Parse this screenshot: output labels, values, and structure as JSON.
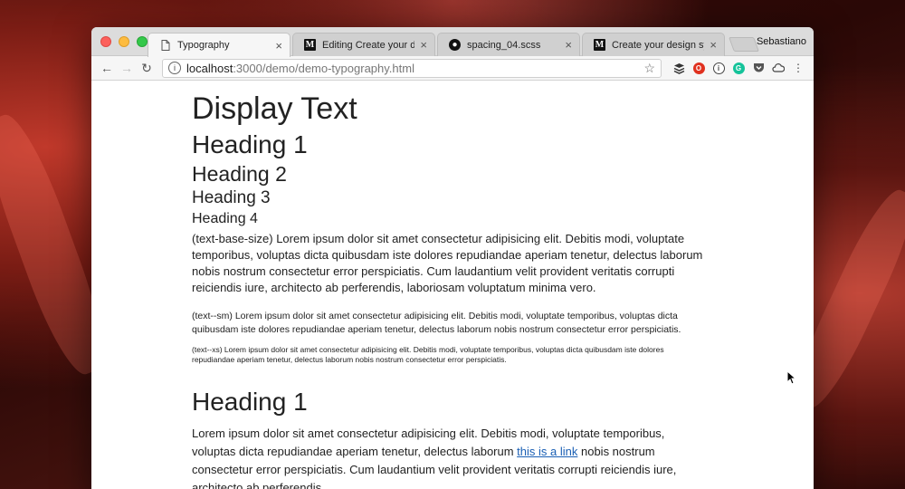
{
  "browser": {
    "tabs": [
      {
        "label": "Typography",
        "icon": "document-icon",
        "active": true
      },
      {
        "label": "Editing Create your desig",
        "icon": "medium-icon",
        "active": false
      },
      {
        "label": "spacing_04.scss",
        "icon": "github-icon",
        "active": false
      },
      {
        "label": "Create your design syste",
        "icon": "medium-icon",
        "active": false
      }
    ],
    "profile_name": "Sebastiano",
    "url_host": "localhost",
    "url_path": ":3000/demo/demo-typography.html"
  },
  "page": {
    "display_text": "Display Text",
    "heading1": "Heading 1",
    "heading2": "Heading 2",
    "heading3": "Heading 3",
    "heading4": "Heading 4",
    "base_paragraph": "(text-base-size) Lorem ipsum dolor sit amet consectetur adipisicing elit. Debitis modi, voluptate temporibus, voluptas dicta quibusdam iste dolores repudiandae aperiam tenetur, delectus laborum nobis nostrum consectetur error perspiciatis. Cum laudantium velit provident veritatis corrupti reiciendis iure, architecto ab perferendis, laboriosam voluptatum minima vero.",
    "sm_paragraph": "(text--sm) Lorem ipsum dolor sit amet consectetur adipisicing elit. Debitis modi, voluptate temporibus, voluptas dicta quibusdam iste dolores repudiandae aperiam tenetur, delectus laborum nobis nostrum consectetur error perspiciatis.",
    "xs_paragraph": "(text--xs) Lorem ipsum dolor sit amet consectetur adipisicing elit. Debitis modi, voluptate temporibus, voluptas dicta quibusdam iste dolores repudiandae aperiam tenetur, delectus laborum nobis nostrum consectetur error perspiciatis.",
    "heading1_second": "Heading 1",
    "final_paragraph_before": "Lorem ipsum dolor sit amet consectetur adipisicing elit. Debitis modi, voluptate temporibus, voluptas dicta repudiandae aperiam tenetur, delectus laborum ",
    "final_paragraph_link": "this is a link",
    "final_paragraph_after": " nobis nostrum consectetur error perspiciatis. Cum laudantium velit provident veritatis corrupti reiciendis iure, architecto ab perferendis,"
  },
  "colors": {
    "link": "#1a5fb4",
    "close_red": "#fc605c",
    "minimize_yellow": "#fdbc40",
    "zoom_green": "#34c84a"
  }
}
